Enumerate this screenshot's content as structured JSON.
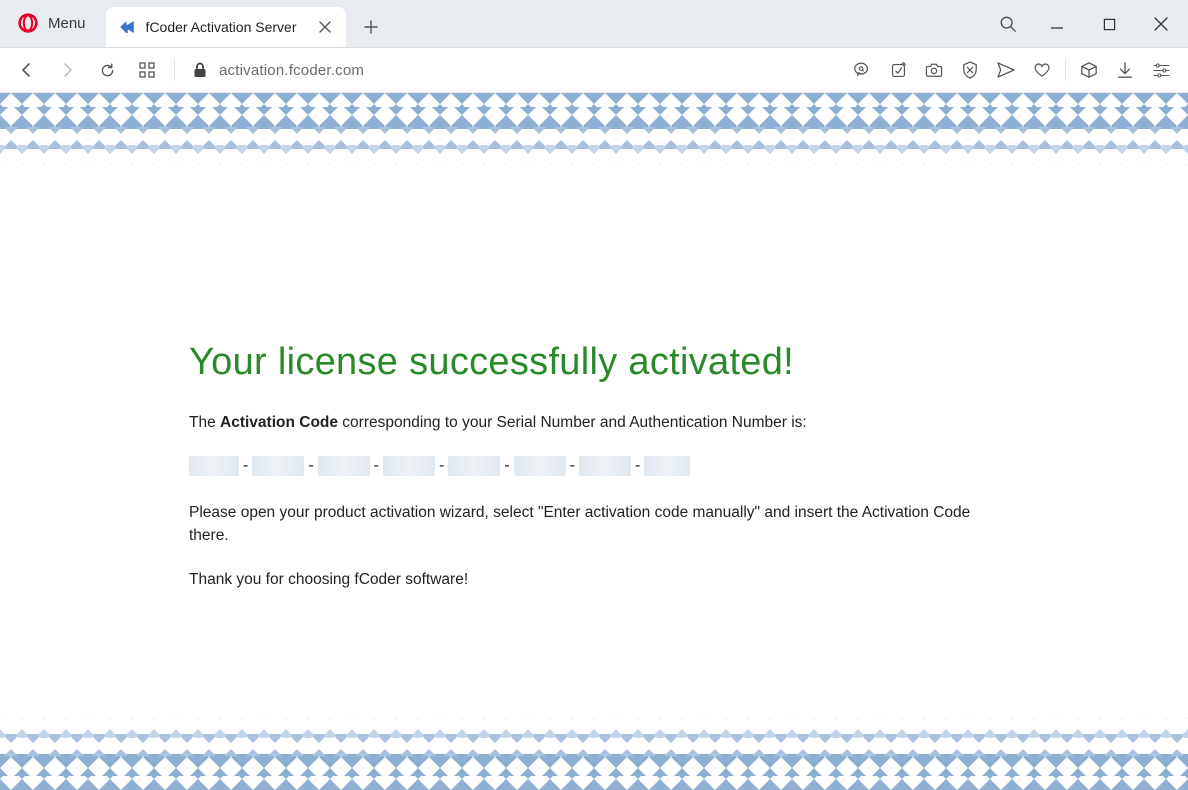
{
  "browser": {
    "menu_label": "Menu",
    "tab_title": "fCoder Activation Server",
    "address": "activation.fcoder.com"
  },
  "page": {
    "heading": "Your license successfully activated!",
    "intro_prefix": "The ",
    "intro_bold": "Activation Code",
    "intro_suffix": " corresponding to your Serial Number and Authentication Number is:",
    "instruction": "Please open your product activation wizard, select \"Enter activation code manually\" and insert the Activation Code there.",
    "thanks": "Thank you for choosing fCoder software!",
    "code_segments": 8,
    "segment_widths": [
      50,
      52,
      52,
      52,
      52,
      52,
      52,
      46
    ]
  }
}
